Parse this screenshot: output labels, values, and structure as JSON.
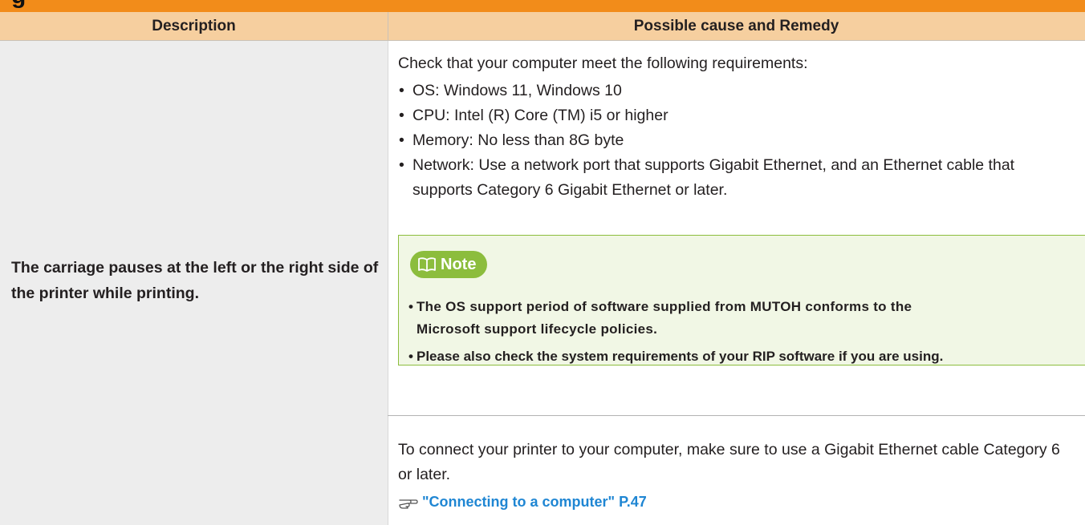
{
  "top_band": {
    "fragment": "g"
  },
  "table": {
    "headers": {
      "description": "Description",
      "cause": "Possible cause and Remedy"
    },
    "description": "The carriage pauses at the left or the right side of the printer while printing.",
    "intro": "Check that your computer meet the following requirements:",
    "requirements": [
      "OS: Windows 11, Windows 10",
      "CPU: Intel (R) Core (TM) i5 or higher",
      "Memory: No less than 8G byte",
      "Network: Use a network port that supports Gigabit Ethernet, and an Ethernet cable that supports Category 6 Gigabit Ethernet or later."
    ],
    "bullet_glyph": "•",
    "note": {
      "title": "Note",
      "icon": "book-icon",
      "item1_line1": "The OS support period of software supplied from MUTOH conforms to the",
      "item1_line2": "Microsoft support lifecycle policies.",
      "item2": "Please also check the system requirements of your RIP software if you are using."
    },
    "connect_text": "To connect your printer to your computer, make sure to use a Gigabit Ethernet cable Category 6 or later.",
    "link": {
      "icon": "pointing-hand-icon",
      "text": "\"Connecting to a computer\" P.47"
    }
  },
  "colors": {
    "orange_band": "#f28c1a",
    "header_bg": "#f6cf9f",
    "desc_bg": "#ededed",
    "note_green": "#8cbd3d",
    "note_bg": "#f1f7e5",
    "link_blue": "#1f86d3"
  }
}
